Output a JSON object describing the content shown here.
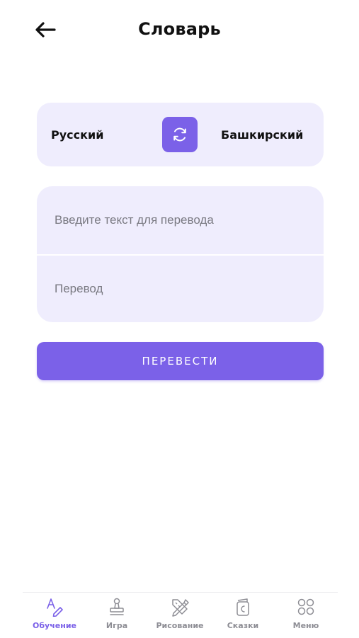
{
  "header": {
    "title": "Словарь",
    "back_icon": "arrow-left-icon"
  },
  "languages": {
    "source": "Русский",
    "target": "Башкирский",
    "swap_icon": "swap-refresh-icon"
  },
  "input": {
    "placeholder": "Введите текст для перевода",
    "value": ""
  },
  "output": {
    "placeholder": "Перевод"
  },
  "actions": {
    "translate_label": "ПЕРЕВЕСТИ"
  },
  "tabbar": {
    "items": [
      {
        "label": "Обучение",
        "icon": "learning-icon",
        "active": true
      },
      {
        "label": "Игра",
        "icon": "game-icon",
        "active": false
      },
      {
        "label": "Рисование",
        "icon": "drawing-icon",
        "active": false
      },
      {
        "label": "Сказки",
        "icon": "tales-book-icon",
        "active": false
      },
      {
        "label": "Меню",
        "icon": "menu-grid-icon",
        "active": false
      }
    ]
  },
  "colors": {
    "accent": "#7b61e8",
    "card_background": "#efedfd",
    "inactive_tab": "#8d8d94"
  }
}
